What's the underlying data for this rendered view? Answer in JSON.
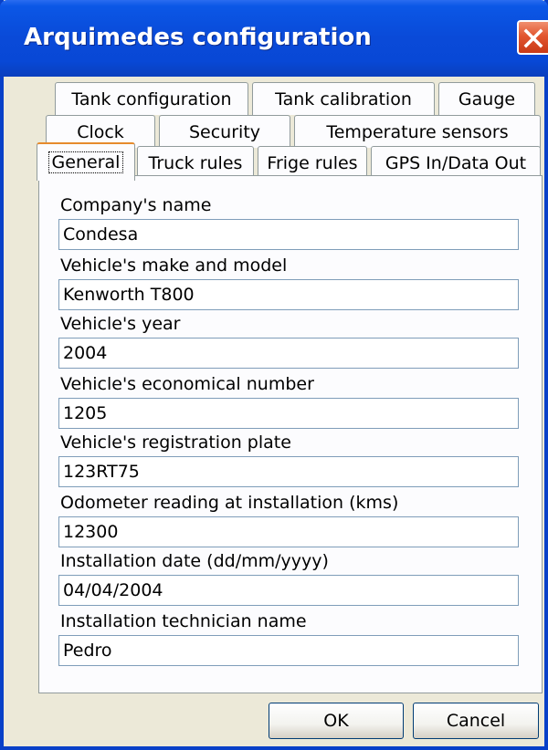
{
  "window": {
    "title": "Arquimedes configuration",
    "close_icon": "close-icon"
  },
  "tabs": {
    "row1": [
      "Tank configuration",
      "Tank calibration",
      "Gauge"
    ],
    "row2": [
      "Clock",
      "Security",
      "Temperature sensors"
    ],
    "row3": [
      "General",
      "Truck rules",
      "Frige rules",
      "GPS In/Data Out"
    ],
    "active": "General"
  },
  "form": {
    "fields": [
      {
        "label": "Company's name",
        "value": "Condesa"
      },
      {
        "label": "Vehicle's make and model",
        "value": "Kenworth T800"
      },
      {
        "label": "Vehicle's year",
        "value": "2004"
      },
      {
        "label": "Vehicle's economical number",
        "value": "1205"
      },
      {
        "label": "Vehicle's registration plate",
        "value": "123RT75"
      },
      {
        "label": "Odometer reading at installation (kms)",
        "value": "12300"
      },
      {
        "label": "Installation date (dd/mm/yyyy)",
        "value": "04/04/2004"
      },
      {
        "label": "Installation technician name",
        "value": "Pedro"
      }
    ]
  },
  "buttons": {
    "ok": "OK",
    "cancel": "Cancel"
  },
  "colors": {
    "titlebar": "#0a4ad8",
    "close": "#e2552f",
    "face": "#ece9d8",
    "active_tab_accent": "#e68b2c"
  }
}
